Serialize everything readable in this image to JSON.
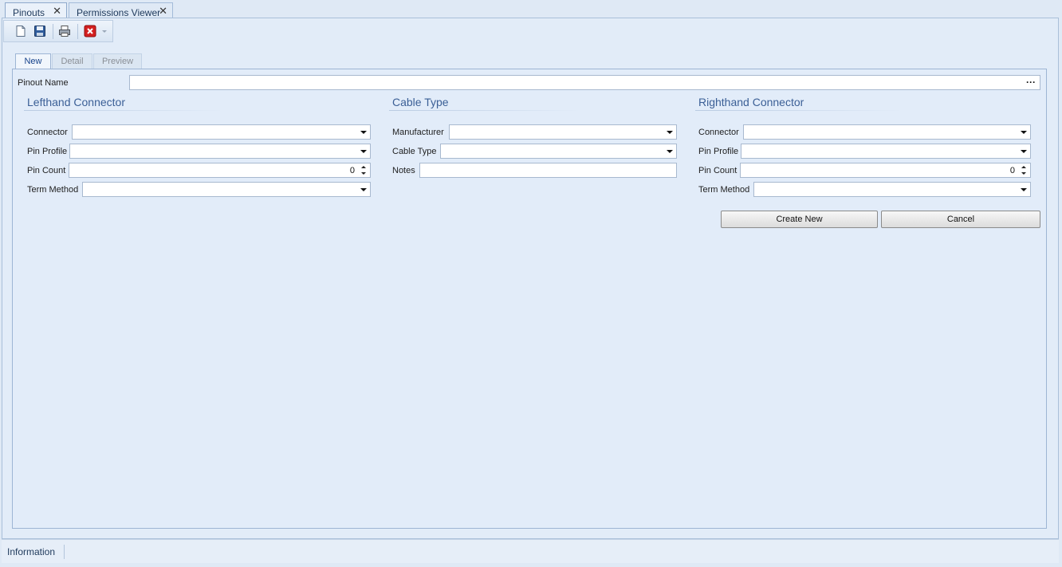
{
  "doc_tabs": [
    {
      "label": "Pinouts",
      "active": true
    },
    {
      "label": "Permissions Viewer",
      "active": false
    }
  ],
  "toolbar": {
    "icons": [
      "new-document-icon",
      "save-icon",
      "print-icon",
      "delete-icon",
      "dropdown-arrow-icon"
    ]
  },
  "inner_tabs": [
    {
      "label": "New",
      "active": true
    },
    {
      "label": "Detail",
      "active": false
    },
    {
      "label": "Preview",
      "active": false
    }
  ],
  "form": {
    "pinout_name": {
      "label": "Pinout Name",
      "value": ""
    },
    "left": {
      "title": "Lefthand Connector",
      "connector": {
        "label": "Connector",
        "value": ""
      },
      "pin_profile": {
        "label": "Pin Profile",
        "value": ""
      },
      "pin_count": {
        "label": "Pin Count",
        "value": "0"
      },
      "term_method": {
        "label": "Term Method",
        "value": ""
      }
    },
    "cable": {
      "title": "Cable Type",
      "manufacturer": {
        "label": "Manufacturer",
        "value": ""
      },
      "cable_type": {
        "label": "Cable Type",
        "value": ""
      },
      "notes": {
        "label": "Notes",
        "value": ""
      }
    },
    "right": {
      "title": "Righthand Connector",
      "connector": {
        "label": "Connector",
        "value": ""
      },
      "pin_profile": {
        "label": "Pin Profile",
        "value": ""
      },
      "pin_count": {
        "label": "Pin Count",
        "value": "0"
      },
      "term_method": {
        "label": "Term Method",
        "value": ""
      }
    },
    "buttons": {
      "create": "Create New",
      "cancel": "Cancel"
    }
  },
  "status": {
    "text": "Information"
  }
}
